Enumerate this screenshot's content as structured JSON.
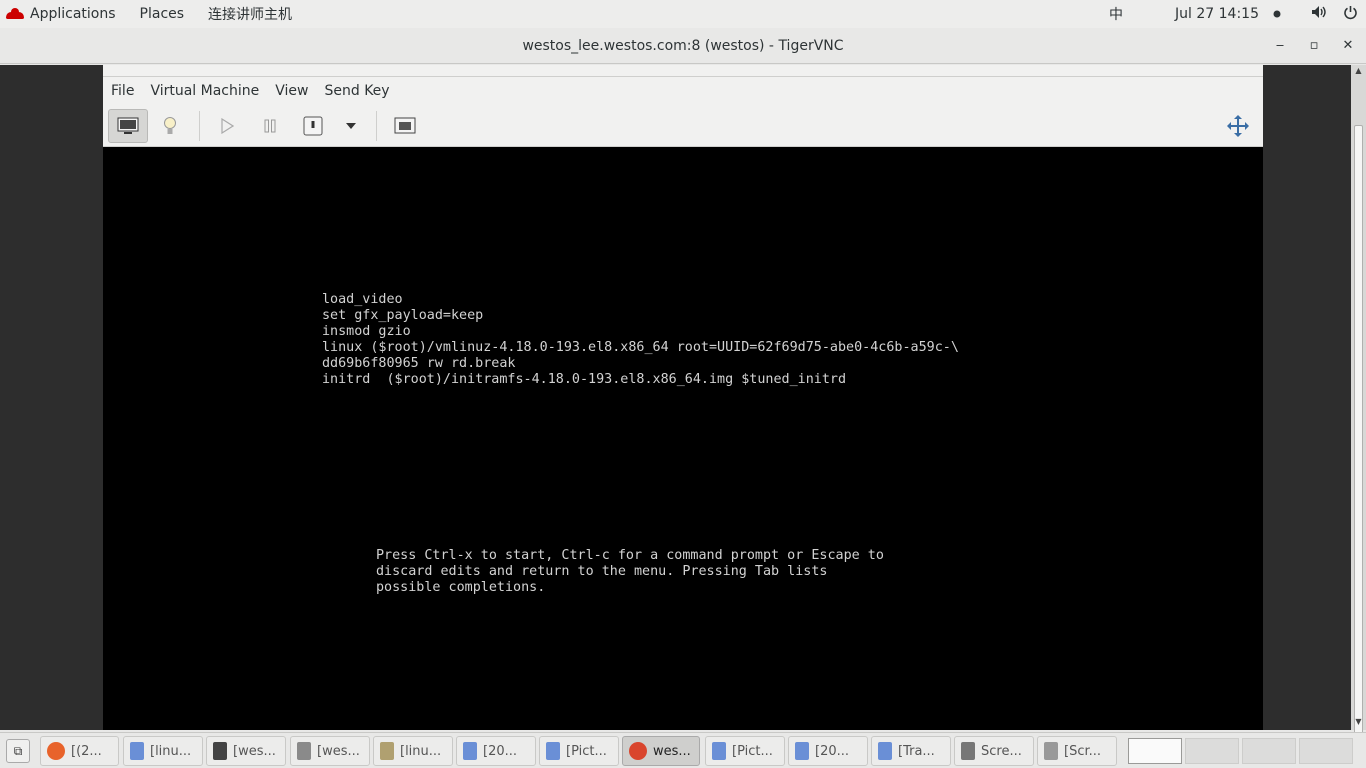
{
  "topbar": {
    "applications": "Applications",
    "places": "Places",
    "custom_menu": "连接讲师主机",
    "input_method": "中",
    "datetime": "Jul 27  14:15",
    "volume_icon": "volume-icon",
    "power_icon": "power-icon"
  },
  "window": {
    "title": "westos_lee.westos.com:8 (westos) - TigerVNC",
    "minimize": "‒",
    "maximize": "▫",
    "close": "✕"
  },
  "vm_menu": {
    "file": "File",
    "virtual_machine": "Virtual Machine",
    "view": "View",
    "send_key": "Send Key"
  },
  "console": {
    "grub_lines": [
      "load_video",
      "set gfx_payload=keep",
      "insmod gzio",
      "linux ($root)/vmlinuz-4.18.0-193.el8.x86_64 root=UUID=62f69d75-abe0-4c6b-a59c-\\",
      "dd69b6f80965 rw rd.break",
      "initrd  ($root)/initramfs-4.18.0-193.el8.x86_64.img $tuned_initrd"
    ],
    "help_lines": [
      "Press Ctrl-x to start, Ctrl-c for a command prompt or Escape to",
      "discard edits and return to the menu. Pressing Tab lists",
      "possible completions."
    ]
  },
  "taskbar": {
    "tasks": [
      {
        "label": "[(2...",
        "icon": "firefox-icon",
        "color": "#e8632b"
      },
      {
        "label": "[linu...",
        "icon": "document-icon",
        "color": "#6a8fd6"
      },
      {
        "label": "[wes...",
        "icon": "terminal-icon",
        "color": "#444444"
      },
      {
        "label": "[wes...",
        "icon": "virt-manager-icon",
        "color": "#8a8a8a"
      },
      {
        "label": "[linu...",
        "icon": "text-editor-icon",
        "color": "#b0a070"
      },
      {
        "label": "[20...",
        "icon": "document-icon",
        "color": "#6a8fd6"
      },
      {
        "label": "[Pict...",
        "icon": "document-icon",
        "color": "#6a8fd6"
      },
      {
        "label": "wes...",
        "icon": "tigervnc-icon",
        "color": "#d9452d"
      },
      {
        "label": "[Pict...",
        "icon": "document-icon",
        "color": "#6a8fd6"
      },
      {
        "label": "[20...",
        "icon": "document-icon",
        "color": "#6a8fd6"
      },
      {
        "label": "[Tra...",
        "icon": "document-icon",
        "color": "#6a8fd6"
      },
      {
        "label": "Scre...",
        "icon": "screenshot-icon",
        "color": "#777777"
      },
      {
        "label": "[Scr...",
        "icon": "screenshot-icon",
        "color": "#999999"
      }
    ],
    "active_task_index": 7
  }
}
